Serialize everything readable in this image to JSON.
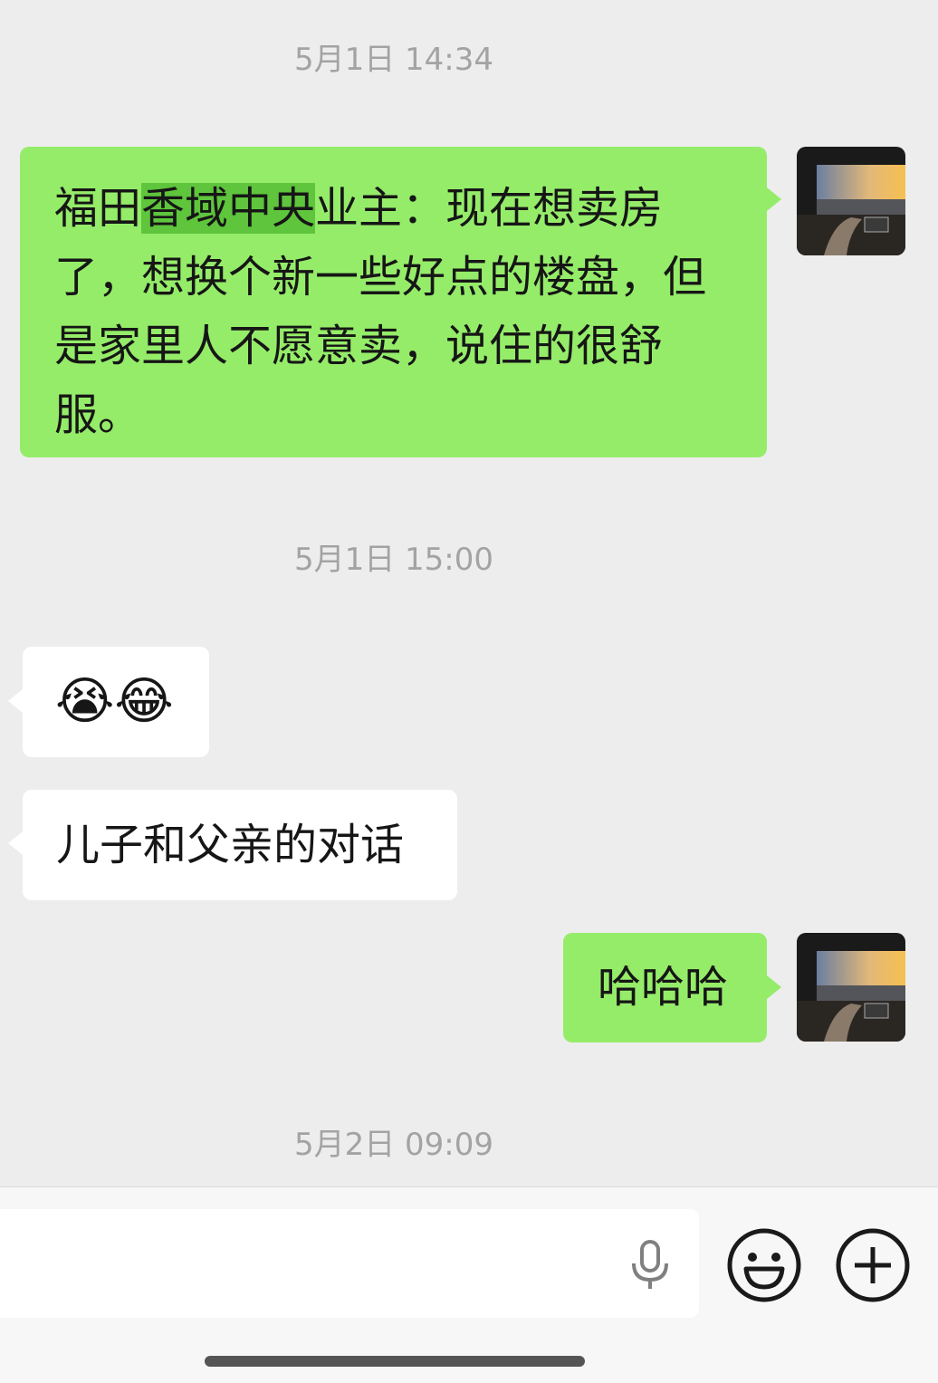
{
  "messages": {
    "ts1": "5月1日 14:34",
    "msg1": {
      "line1_pre": "福田",
      "line1_hl": "香域中央",
      "line1_post": "业主：现在想卖房",
      "line2": "了，想换个新一些好点的楼盘，但",
      "line3": "是家里人不愿意卖，说住的很舒",
      "line4": "服。"
    },
    "ts2": "5月1日 15:00",
    "msg2_emoji": "😭😂",
    "msg3": "儿子和父亲的对话",
    "msg4": "哈哈哈",
    "ts3": "5月2日 09:09"
  },
  "input_bar": {
    "placeholder": "",
    "icons": [
      "microphone-icon",
      "emoji-icon",
      "plus-icon"
    ]
  },
  "colors": {
    "background": "#ededed",
    "outgoing_bubble": "#95ec69",
    "incoming_bubble": "#ffffff",
    "highlight": "#5ec53c",
    "timestamp": "#a3a3a3"
  }
}
